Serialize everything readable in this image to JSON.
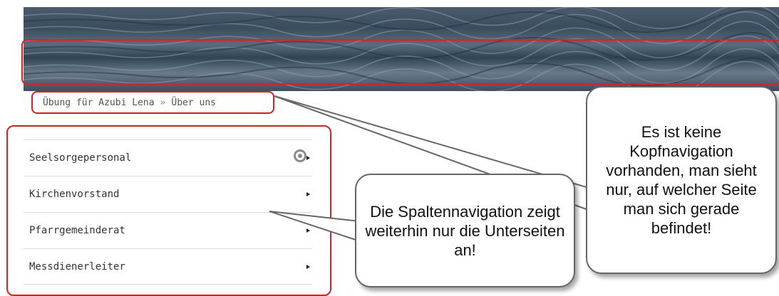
{
  "breadcrumb": {
    "items": [
      "Übung für Azubi Lena",
      "Über uns"
    ],
    "separator": "»"
  },
  "sidebar": {
    "items": [
      {
        "label": "Seelsorgepersonal"
      },
      {
        "label": "Kirchenvorstand"
      },
      {
        "label": "Pfarrgemeinderat"
      },
      {
        "label": "Messdienerleiter"
      }
    ]
  },
  "callouts": {
    "right": "Es ist keine Kopfnavigation vorhanden, man sieht nur, auf welcher Seite man sich gerade befindet!",
    "middle": "Die Spaltennavigation zeigt weiterhin nur die Unterseiten an!"
  },
  "colors": {
    "highlight": "#e02020",
    "callout_border": "#666666"
  }
}
